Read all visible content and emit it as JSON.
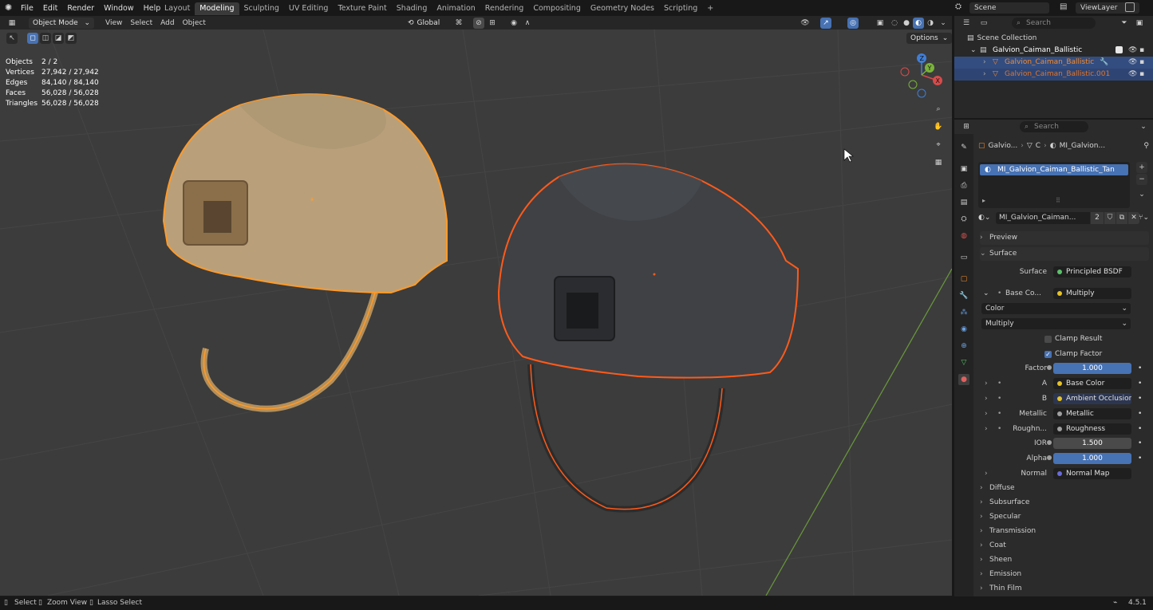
{
  "menu": [
    "File",
    "Edit",
    "Render",
    "Window",
    "Help"
  ],
  "workspaces": [
    {
      "label": "Layout",
      "active": false
    },
    {
      "label": "Modeling",
      "active": true
    },
    {
      "label": "Sculpting",
      "active": false
    },
    {
      "label": "UV Editing",
      "active": false
    },
    {
      "label": "Texture Paint",
      "active": false
    },
    {
      "label": "Shading",
      "active": false
    },
    {
      "label": "Animation",
      "active": false
    },
    {
      "label": "Rendering",
      "active": false
    },
    {
      "label": "Compositing",
      "active": false
    },
    {
      "label": "Geometry Nodes",
      "active": false
    },
    {
      "label": "Scripting",
      "active": false
    }
  ],
  "add_workspace": "+",
  "scene": "Scene",
  "viewlayer": "ViewLayer",
  "viewport_header": {
    "mode": "Object Mode",
    "menus": [
      "View",
      "Select",
      "Add",
      "Object"
    ],
    "transform": "Global",
    "options": "Options"
  },
  "stats": [
    {
      "k": "Objects",
      "v": "2 / 2"
    },
    {
      "k": "Vertices",
      "v": "27,942 / 27,942"
    },
    {
      "k": "Edges",
      "v": "84,140 / 84,140"
    },
    {
      "k": "Faces",
      "v": "56,028 / 56,028"
    },
    {
      "k": "Triangles",
      "v": "56,028 / 56,028"
    }
  ],
  "gizmo": {
    "x": "X",
    "y": "Y",
    "z": "Z"
  },
  "outliner": {
    "search": "Search",
    "collection": "Scene Collection",
    "root": "Galvion_Caiman_Ballistic",
    "items": [
      "Galvion_Caiman_Ballistic",
      "Galvion_Caiman_Ballistic.001"
    ]
  },
  "properties": {
    "search": "Search",
    "breadcrumb": [
      "Galvio...",
      "C",
      "MI_Galvion..."
    ],
    "slot": "MI_Galvion_Caiman_Ballistic_Tan",
    "material_name": "MI_Galvion_Caiman...",
    "users": "2",
    "preview": "Preview",
    "surface_section": "Surface",
    "surface_label": "Surface",
    "surface_value": "Principled BSDF",
    "basecolor_label": "Base Co...",
    "basecolor_value": "Multiply",
    "color_mode": "Color",
    "blend_mode": "Multiply",
    "clamp_result": "Clamp Result",
    "clamp_factor": "Clamp Factor",
    "factor_label": "Factor",
    "factor_value": "1.000",
    "a_label": "A",
    "a_value": "Base Color",
    "b_label": "B",
    "b_value": "Ambient Occlusion",
    "metallic_label": "Metallic",
    "metallic_value": "Metallic",
    "rough_label": "Roughn...",
    "rough_value": "Roughness",
    "ior_label": "IOR",
    "ior_value": "1.500",
    "alpha_label": "Alpha",
    "alpha_value": "1.000",
    "normal_label": "Normal",
    "normal_value": "Normal Map",
    "sections": [
      "Diffuse",
      "Subsurface",
      "Specular",
      "Transmission",
      "Coat",
      "Sheen",
      "Emission",
      "Thin Film"
    ]
  },
  "statusbar": {
    "select": "Select",
    "zoom": "Zoom View",
    "lasso": "Lasso Select",
    "version": "4.5.1"
  },
  "colors": {
    "accent": "#4772b3",
    "selected_outline": "#ff8c1a",
    "active_orange": "#f28b2e"
  }
}
